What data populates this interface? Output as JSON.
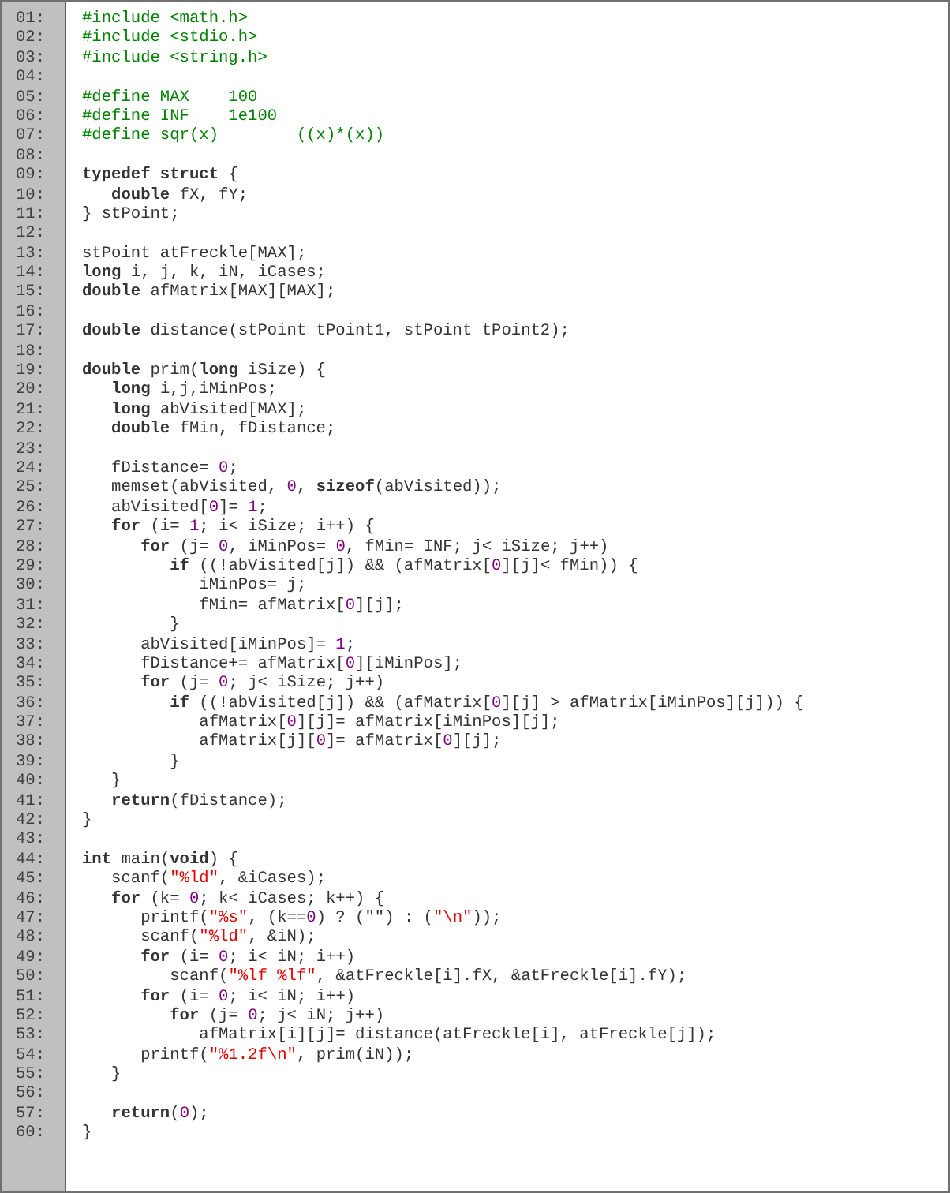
{
  "lines": [
    {
      "number": "01:",
      "tokens": [
        {
          "kind": "directive",
          "text": "#include <math.h>"
        }
      ]
    },
    {
      "number": "02:",
      "tokens": [
        {
          "kind": "directive",
          "text": "#include <stdio.h>"
        }
      ]
    },
    {
      "number": "03:",
      "tokens": [
        {
          "kind": "directive",
          "text": "#include <string.h>"
        }
      ]
    },
    {
      "number": "04:"
    },
    {
      "number": "05:",
      "tokens": [
        {
          "kind": "directive",
          "text": "#define MAX    100"
        }
      ]
    },
    {
      "number": "06:",
      "tokens": [
        {
          "kind": "directive",
          "text": "#define INF    1e100"
        }
      ]
    },
    {
      "number": "07:",
      "tokens": [
        {
          "kind": "directive",
          "text": "#define sqr(x)        ((x)*(x))"
        }
      ]
    },
    {
      "number": "08:"
    },
    {
      "number": "09:",
      "tokens": [
        {
          "kind": "keyword",
          "text": "typedef struct"
        },
        {
          "kind": "plain",
          "text": " {"
        }
      ]
    },
    {
      "number": "10:",
      "tokens": [
        {
          "kind": "keyword",
          "text": "   double"
        },
        {
          "kind": "plain",
          "text": " fX, fY;"
        }
      ]
    },
    {
      "number": "11:",
      "tokens": [
        {
          "kind": "plain",
          "text": "} stPoint;"
        }
      ]
    },
    {
      "number": "12:"
    },
    {
      "number": "13:",
      "tokens": [
        {
          "kind": "plain",
          "text": "stPoint atFreckle[MAX];"
        }
      ]
    },
    {
      "number": "14:",
      "tokens": [
        {
          "kind": "keyword",
          "text": "long"
        },
        {
          "kind": "plain",
          "text": " i, j, k, iN, iCases;"
        }
      ]
    },
    {
      "number": "15:",
      "tokens": [
        {
          "kind": "keyword",
          "text": "double"
        },
        {
          "kind": "plain",
          "text": " afMatrix[MAX][MAX];"
        }
      ]
    },
    {
      "number": "16:"
    },
    {
      "number": "17:",
      "tokens": [
        {
          "kind": "keyword",
          "text": "double"
        },
        {
          "kind": "plain",
          "text": " distance(stPoint tPoint1, stPoint tPoint2);"
        }
      ]
    },
    {
      "number": "18:"
    },
    {
      "number": "19:",
      "tokens": [
        {
          "kind": "keyword",
          "text": "double"
        },
        {
          "kind": "plain",
          "text": " prim("
        },
        {
          "kind": "keyword",
          "text": "long"
        },
        {
          "kind": "plain",
          "text": " iSize) {"
        }
      ]
    },
    {
      "number": "20:",
      "tokens": [
        {
          "kind": "keyword",
          "text": "   long"
        },
        {
          "kind": "plain",
          "text": " i,j,iMinPos;"
        }
      ]
    },
    {
      "number": "21:",
      "tokens": [
        {
          "kind": "keyword",
          "text": "   long"
        },
        {
          "kind": "plain",
          "text": " abVisited[MAX];"
        }
      ]
    },
    {
      "number": "22:",
      "tokens": [
        {
          "kind": "keyword",
          "text": "   double"
        },
        {
          "kind": "plain",
          "text": " fMin, fDistance;"
        }
      ]
    },
    {
      "number": "23:"
    },
    {
      "number": "24:",
      "tokens": [
        {
          "kind": "plain",
          "text": "   fDistance= "
        },
        {
          "kind": "number",
          "text": "0"
        },
        {
          "kind": "plain",
          "text": ";"
        }
      ]
    },
    {
      "number": "25:",
      "tokens": [
        {
          "kind": "plain",
          "text": "   memset(abVisited, "
        },
        {
          "kind": "number",
          "text": "0"
        },
        {
          "kind": "plain",
          "text": ", "
        },
        {
          "kind": "keyword",
          "text": "sizeof"
        },
        {
          "kind": "plain",
          "text": "(abVisited));"
        }
      ]
    },
    {
      "number": "26:",
      "tokens": [
        {
          "kind": "plain",
          "text": "   abVisited["
        },
        {
          "kind": "number",
          "text": "0"
        },
        {
          "kind": "plain",
          "text": "]= "
        },
        {
          "kind": "number",
          "text": "1"
        },
        {
          "kind": "plain",
          "text": ";"
        }
      ]
    },
    {
      "number": "27:",
      "tokens": [
        {
          "kind": "keyword",
          "text": "   for"
        },
        {
          "kind": "plain",
          "text": " (i= "
        },
        {
          "kind": "number",
          "text": "1"
        },
        {
          "kind": "plain",
          "text": "; i< iSize; i++) {"
        }
      ]
    },
    {
      "number": "28:",
      "tokens": [
        {
          "kind": "keyword",
          "text": "      for"
        },
        {
          "kind": "plain",
          "text": " (j= "
        },
        {
          "kind": "number",
          "text": "0"
        },
        {
          "kind": "plain",
          "text": ", iMinPos= "
        },
        {
          "kind": "number",
          "text": "0"
        },
        {
          "kind": "plain",
          "text": ", fMin= INF; j< iSize; j++)"
        }
      ]
    },
    {
      "number": "29:",
      "tokens": [
        {
          "kind": "keyword",
          "text": "         if"
        },
        {
          "kind": "plain",
          "text": " ((!abVisited[j]) && (afMatrix["
        },
        {
          "kind": "number",
          "text": "0"
        },
        {
          "kind": "plain",
          "text": "][j]< fMin)) {"
        }
      ]
    },
    {
      "number": "30:",
      "tokens": [
        {
          "kind": "plain",
          "text": "            iMinPos= j;"
        }
      ]
    },
    {
      "number": "31:",
      "tokens": [
        {
          "kind": "plain",
          "text": "            fMin= afMatrix["
        },
        {
          "kind": "number",
          "text": "0"
        },
        {
          "kind": "plain",
          "text": "][j];"
        }
      ]
    },
    {
      "number": "32:",
      "tokens": [
        {
          "kind": "plain",
          "text": "         }"
        }
      ]
    },
    {
      "number": "33:",
      "tokens": [
        {
          "kind": "plain",
          "text": "      abVisited[iMinPos]= "
        },
        {
          "kind": "number",
          "text": "1"
        },
        {
          "kind": "plain",
          "text": ";"
        }
      ]
    },
    {
      "number": "34:",
      "tokens": [
        {
          "kind": "plain",
          "text": "      fDistance+= afMatrix["
        },
        {
          "kind": "number",
          "text": "0"
        },
        {
          "kind": "plain",
          "text": "][iMinPos];"
        }
      ]
    },
    {
      "number": "35:",
      "tokens": [
        {
          "kind": "keyword",
          "text": "      for"
        },
        {
          "kind": "plain",
          "text": " (j= "
        },
        {
          "kind": "number",
          "text": "0"
        },
        {
          "kind": "plain",
          "text": "; j< iSize; j++)"
        }
      ]
    },
    {
      "number": "36:",
      "tokens": [
        {
          "kind": "keyword",
          "text": "         if"
        },
        {
          "kind": "plain",
          "text": " ((!abVisited[j]) && (afMatrix["
        },
        {
          "kind": "number",
          "text": "0"
        },
        {
          "kind": "plain",
          "text": "][j] > afMatrix[iMinPos][j])) {"
        }
      ]
    },
    {
      "number": "37:",
      "tokens": [
        {
          "kind": "plain",
          "text": "            afMatrix["
        },
        {
          "kind": "number",
          "text": "0"
        },
        {
          "kind": "plain",
          "text": "][j]= afMatrix[iMinPos][j];"
        }
      ]
    },
    {
      "number": "38:",
      "tokens": [
        {
          "kind": "plain",
          "text": "            afMatrix[j]["
        },
        {
          "kind": "number",
          "text": "0"
        },
        {
          "kind": "plain",
          "text": "]= afMatrix["
        },
        {
          "kind": "number",
          "text": "0"
        },
        {
          "kind": "plain",
          "text": "][j];"
        }
      ]
    },
    {
      "number": "39:",
      "tokens": [
        {
          "kind": "plain",
          "text": "         }"
        }
      ]
    },
    {
      "number": "40:",
      "tokens": [
        {
          "kind": "plain",
          "text": "   }"
        }
      ]
    },
    {
      "number": "41:",
      "tokens": [
        {
          "kind": "keyword",
          "text": "   return"
        },
        {
          "kind": "plain",
          "text": "(fDistance);"
        }
      ]
    },
    {
      "number": "42:",
      "tokens": [
        {
          "kind": "plain",
          "text": "}"
        }
      ]
    },
    {
      "number": "43:"
    },
    {
      "number": "44:",
      "tokens": [
        {
          "kind": "keyword",
          "text": "int"
        },
        {
          "kind": "plain",
          "text": " main("
        },
        {
          "kind": "keyword",
          "text": "void"
        },
        {
          "kind": "plain",
          "text": ") {"
        }
      ]
    },
    {
      "number": "45:",
      "tokens": [
        {
          "kind": "plain",
          "text": "   scanf("
        },
        {
          "kind": "string",
          "text": "\"%ld\""
        },
        {
          "kind": "plain",
          "text": ", &iCases);"
        }
      ]
    },
    {
      "number": "46:",
      "tokens": [
        {
          "kind": "keyword",
          "text": "   for"
        },
        {
          "kind": "plain",
          "text": " (k= "
        },
        {
          "kind": "number",
          "text": "0"
        },
        {
          "kind": "plain",
          "text": "; k< iCases; k++) {"
        }
      ]
    },
    {
      "number": "47:",
      "tokens": [
        {
          "kind": "plain",
          "text": "      printf("
        },
        {
          "kind": "string",
          "text": "\"%s\""
        },
        {
          "kind": "plain",
          "text": ", (k=="
        },
        {
          "kind": "number",
          "text": "0"
        },
        {
          "kind": "plain",
          "text": ") ? (\"\") : ("
        },
        {
          "kind": "string",
          "text": "\"\\n\""
        },
        {
          "kind": "plain",
          "text": "));"
        }
      ]
    },
    {
      "number": "48:",
      "tokens": [
        {
          "kind": "plain",
          "text": "      scanf("
        },
        {
          "kind": "string",
          "text": "\"%ld\""
        },
        {
          "kind": "plain",
          "text": ", &iN);"
        }
      ]
    },
    {
      "number": "49:",
      "tokens": [
        {
          "kind": "keyword",
          "text": "      for"
        },
        {
          "kind": "plain",
          "text": " (i= "
        },
        {
          "kind": "number",
          "text": "0"
        },
        {
          "kind": "plain",
          "text": "; i< iN; i++)"
        }
      ]
    },
    {
      "number": "50:",
      "tokens": [
        {
          "kind": "plain",
          "text": "         scanf("
        },
        {
          "kind": "string",
          "text": "\"%lf %lf\""
        },
        {
          "kind": "plain",
          "text": ", &atFreckle[i].fX, &atFreckle[i].fY);"
        }
      ]
    },
    {
      "number": "51:",
      "tokens": [
        {
          "kind": "keyword",
          "text": "      for"
        },
        {
          "kind": "plain",
          "text": " (i= "
        },
        {
          "kind": "number",
          "text": "0"
        },
        {
          "kind": "plain",
          "text": "; i< iN; i++)"
        }
      ]
    },
    {
      "number": "52:",
      "tokens": [
        {
          "kind": "keyword",
          "text": "         for"
        },
        {
          "kind": "plain",
          "text": " (j= "
        },
        {
          "kind": "number",
          "text": "0"
        },
        {
          "kind": "plain",
          "text": "; j< iN; j++)"
        }
      ]
    },
    {
      "number": "53:",
      "tokens": [
        {
          "kind": "plain",
          "text": "            afMatrix[i][j]= distance(atFreckle[i], atFreckle[j]);"
        }
      ]
    },
    {
      "number": "54:",
      "tokens": [
        {
          "kind": "plain",
          "text": "      printf("
        },
        {
          "kind": "string",
          "text": "\"%1.2f\\n\""
        },
        {
          "kind": "plain",
          "text": ", prim(iN));"
        }
      ]
    },
    {
      "number": "55:",
      "tokens": [
        {
          "kind": "plain",
          "text": "   }"
        }
      ]
    },
    {
      "number": "56:"
    },
    {
      "number": "57:",
      "tokens": [
        {
          "kind": "keyword",
          "text": "   return"
        },
        {
          "kind": "plain",
          "text": "("
        },
        {
          "kind": "number",
          "text": "0"
        },
        {
          "kind": "plain",
          "text": ");"
        }
      ]
    },
    {
      "number": "60:",
      "tokens": [
        {
          "kind": "plain",
          "text": "}"
        }
      ]
    }
  ]
}
